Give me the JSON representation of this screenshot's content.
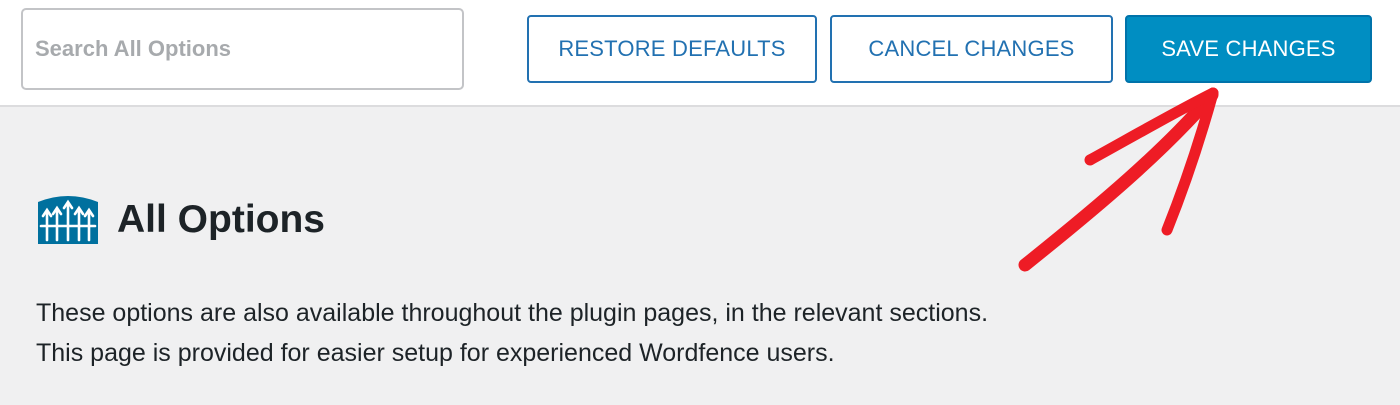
{
  "toolbar": {
    "search_placeholder": "Search All Options",
    "search_value": "",
    "restore_label": "RESTORE DEFAULTS",
    "cancel_label": "CANCEL CHANGES",
    "save_label": "SAVE CHANGES"
  },
  "section": {
    "title": "All Options",
    "icon": "wordfence-logo-icon",
    "description_lines": [
      "These options are also available throughout the plugin pages, in the relevant sections.",
      "This page is provided for easier setup for experienced Wordfence users."
    ]
  },
  "annotation": {
    "icon": "red-arrow-annotation",
    "color": "#ee1c25"
  },
  "colors": {
    "accent": "#2271b1",
    "primary_button": "#008ec2",
    "logo": "#00709e",
    "page_background": "#f0f0f1"
  }
}
